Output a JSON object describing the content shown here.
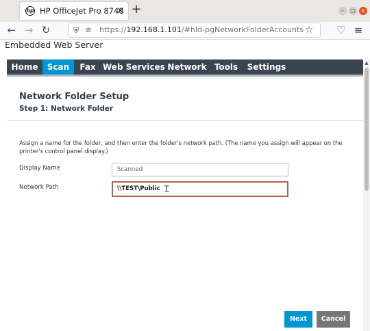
{
  "browser": {
    "tab_title": "HP OfficeJet Pro 8740",
    "tab_favicon": "hp",
    "new_tab": "+",
    "tab_close": "×",
    "url_scheme": "https://",
    "url_host": "192.168.1.101",
    "url_path": "/#hId-pgNetworkFolderAccounts",
    "icons": {
      "back": "←",
      "forward": "→",
      "reload": "↻",
      "shield": "⛨",
      "lock": "⊘",
      "star": "☆",
      "pocket": "♡",
      "menu": "≡",
      "minimize": "–",
      "maximize": "□",
      "close": "×"
    }
  },
  "page": {
    "ews_title": "Embedded Web Server",
    "menu": [
      {
        "label": "Home"
      },
      {
        "label": "Scan"
      },
      {
        "label": "Fax"
      },
      {
        "label": "Web Services"
      },
      {
        "label": "Network"
      },
      {
        "label": "Tools"
      },
      {
        "label": "Settings"
      }
    ],
    "active_menu": "Scan",
    "active_color": "#0096d6",
    "section_title": "Network Folder Setup",
    "section_subtitle": "Step 1: Network Folder",
    "instructions": "Assign a name for the folder, and then enter the folder's network path. (The name you assign will appear on the printer's control panel display.)",
    "fields": {
      "display_name_label": "Display Name",
      "display_name_value": "Scanned",
      "network_path_label": "Network Path",
      "network_path_value": "\\\\TEST\\Public"
    },
    "buttons": {
      "next": "Next",
      "cancel": "Cancel"
    }
  }
}
